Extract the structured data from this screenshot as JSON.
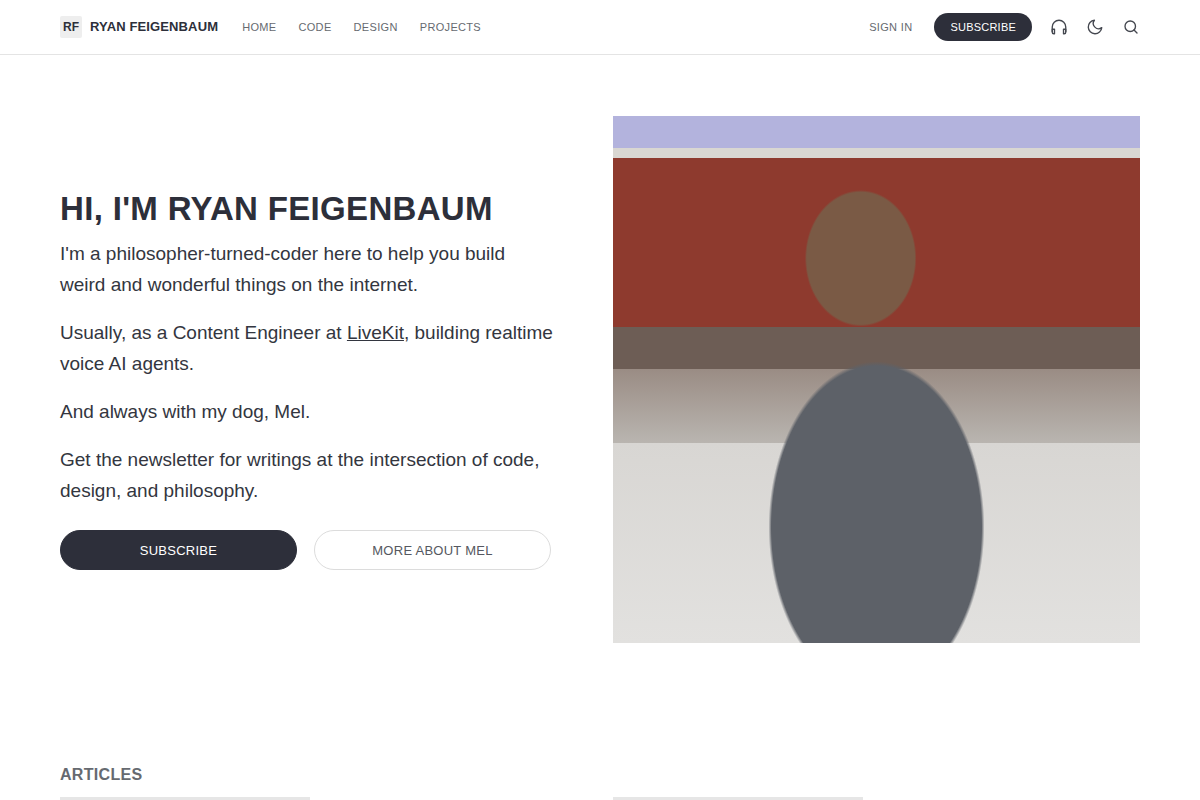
{
  "nav": {
    "logo": "RF",
    "brand": "RYAN FEIGENBAUM",
    "links": [
      {
        "label": "HOME"
      },
      {
        "label": "CODE"
      },
      {
        "label": "DESIGN"
      },
      {
        "label": "PROJECTS"
      }
    ],
    "signin": "SIGN IN",
    "subscribe": "SUBSCRIBE"
  },
  "hero": {
    "title": "HI, I'M RYAN FEIGENBAUM",
    "paragraphs": [
      [
        {
          "text": "I'm a philosopher-turned-coder here to help you build weird and wonderful things on the internet.",
          "kind": "text"
        }
      ],
      [
        {
          "text": "Usually, as a Content Engineer at ",
          "kind": "text"
        },
        {
          "text": "LiveKit",
          "kind": "link"
        },
        {
          "text": ", building realtime voice AI agents.",
          "kind": "text"
        }
      ],
      [
        {
          "text": "And always with my dog, Mel.",
          "kind": "text"
        }
      ],
      [
        {
          "text": "Get the newsletter for writings at the intersection of code, design, and philosophy.",
          "kind": "text"
        }
      ]
    ],
    "buttons": [
      {
        "label": "SUBSCRIBE",
        "kind": "primary"
      },
      {
        "label": "MORE ABOUT MEL",
        "kind": "outline"
      }
    ]
  },
  "articles": {
    "heading": "ARTICLES"
  }
}
